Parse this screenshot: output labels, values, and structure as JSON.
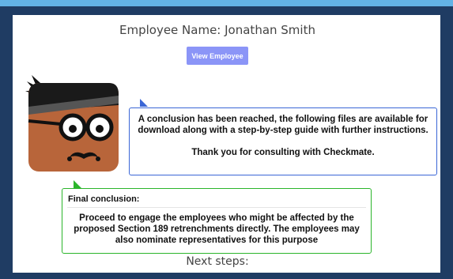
{
  "header": {
    "employee_name": "Employee Name: Jonathan Smith",
    "view_button_label": "View Employee"
  },
  "avatar": {
    "icon": "checkmate-mascot-icon"
  },
  "info_bubble": {
    "message": "A conclusion has been reached, the following files are available for download along with a step-by-step guide with further instructions.",
    "thanks": "Thank you for consulting with Checkmate."
  },
  "conclusion_bubble": {
    "title": "Final conclusion:",
    "text": "Proceed to engage the employees who might be affected by the proposed Section 189 retrenchments directly. The employees may also nominate representatives for this purpose"
  },
  "footer": {
    "next_steps": "Next steps:"
  },
  "colors": {
    "top_bar": "#63b3e6",
    "background": "#1f3c63",
    "button": "#8b95f7",
    "info_border": "#3a66d6",
    "conclusion_border": "#2bb52b"
  }
}
